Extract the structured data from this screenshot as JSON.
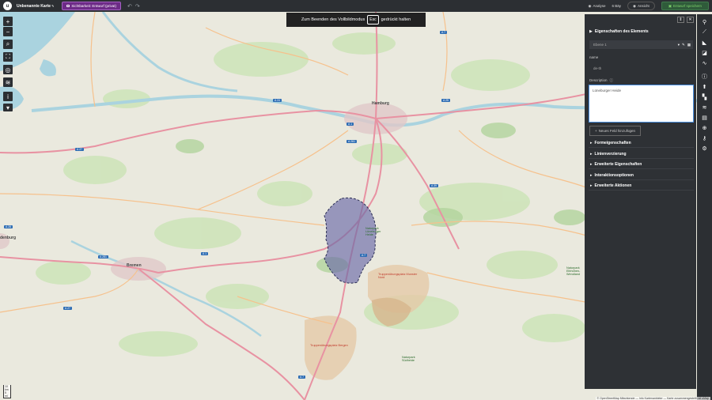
{
  "topbar": {
    "map_title": "Unbenannte Karte",
    "visibility_label": "Sichtbarkeit: Entwurf (privat)",
    "analysis_label": "Analyse",
    "history_label": "6 Bäy",
    "view_label": "Ansicht",
    "save_label": "Entwurf speichern"
  },
  "fullscreen_banner": {
    "text_before": "Zum Beenden des Vollbildmodus",
    "key": "Esc",
    "text_after": "gedrückt halten"
  },
  "panel": {
    "title": "Eigenschaften des Elements",
    "layer_value": "Ebene 1",
    "name_label": "name",
    "name_value": "de-th",
    "description_label": "Description",
    "description_value": "Lüneburger Heide",
    "add_field_label": "Neues Feld hinzufügen",
    "sections": [
      "Formeigenschaften",
      "Linienverzierung",
      "Erweiterte Eigenschaften",
      "Interaktionsoptionen",
      "Erweiterte Aktionen"
    ]
  },
  "map": {
    "labels": {
      "hamburg": "Hamburg",
      "bremen": "Bremen",
      "brandenburg": "denburg",
      "heide": "Naturpark Lüneburger Heide",
      "soltau": "Truppenübungsplatz Munster Nord",
      "bergen": "Truppenübungsplatz Bergen",
      "suedheide": "Naturpark Südheide",
      "wendland": "Naturpark Elbhöhen-Wendland"
    },
    "shields": [
      "A 7",
      "A 1",
      "A 27",
      "A 261",
      "A 39",
      "A 25",
      "A 24",
      "A 28",
      "A 281",
      "A 7",
      "A 1",
      "A 27",
      "A 7"
    ]
  },
  "attribution": {
    "text": "© OpenStreetMap Mitwirkende — Info Kartenanbieter — Karte zusammengestellt mit uMap"
  },
  "scale": {
    "km": "10 km",
    "mi": "5 mi"
  },
  "colors": {
    "topbar_bg": "#2c2f33",
    "visibility_bg": "#6d2b87",
    "save_bg": "#2f5b3a",
    "polygon_fill": "#6a6aa8",
    "panel_bg": "#2e3135"
  }
}
